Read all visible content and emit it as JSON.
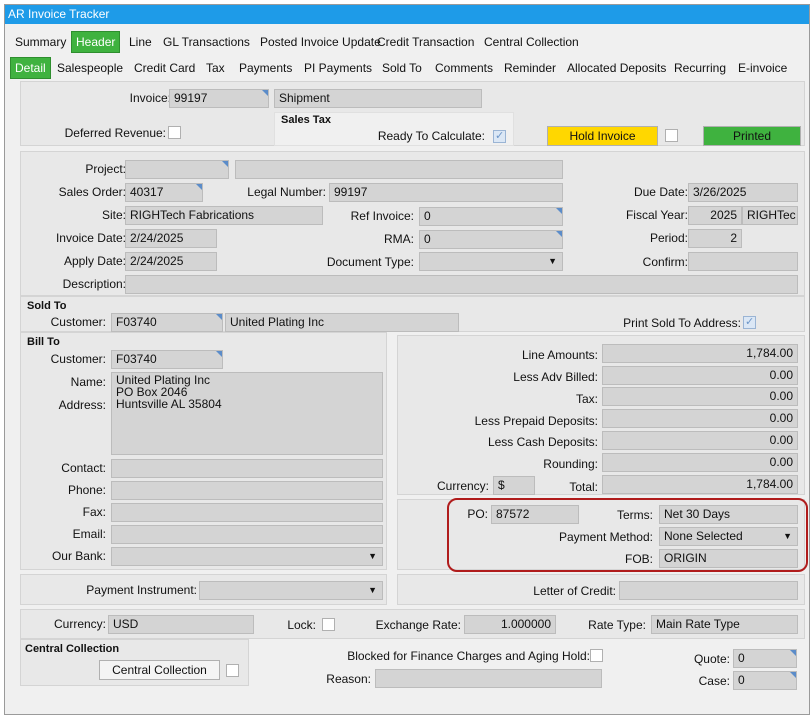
{
  "window": {
    "title": "AR Invoice Tracker"
  },
  "tabs1": [
    "Summary",
    "Header",
    "Line",
    "GL Transactions",
    "Posted Invoice Update",
    "Credit Transaction",
    "Central Collection"
  ],
  "tabs2": [
    "Detail",
    "Salespeople",
    "Credit Card",
    "Tax",
    "Payments",
    "PI Payments",
    "Sold To",
    "Comments",
    "Reminder",
    "Allocated Deposits",
    "Recurring",
    "E-invoice"
  ],
  "top": {
    "invoice_label": "Invoice:",
    "invoice_value": "99197",
    "type_value": "Shipment",
    "deferred_label": "Deferred Revenue:",
    "sales_tax_header": "Sales Tax",
    "ready_label": "Ready To Calculate:",
    "hold_button": "Hold Invoice",
    "printed_button": "Printed"
  },
  "detail": {
    "project_label": "Project:",
    "project_value": "",
    "project_desc": "",
    "sales_order_label": "Sales Order:",
    "sales_order_value": "40317",
    "legal_label": "Legal Number:",
    "legal_value": "99197",
    "due_label": "Due Date:",
    "due_value": "3/26/2025",
    "site_label": "Site:",
    "site_value": "RIGHTech Fabrications",
    "ref_label": "Ref Invoice:",
    "ref_value": "0",
    "fiscal_label": "Fiscal Year:",
    "fiscal_value": "2025",
    "fiscal_company": "RIGHTec",
    "invoice_date_label": "Invoice Date:",
    "invoice_date_value": "2/24/2025",
    "rma_label": "RMA:",
    "rma_value": "0",
    "period_label": "Period:",
    "period_value": "2",
    "apply_label": "Apply Date:",
    "apply_value": "2/24/2025",
    "doctype_label": "Document Type:",
    "doctype_value": "",
    "confirm_label": "Confirm:",
    "confirm_value": "",
    "desc_label": "Description:",
    "desc_value": ""
  },
  "sold_to": {
    "header": "Sold To",
    "customer_label": "Customer:",
    "customer_id": "F03740",
    "customer_name": "United Plating Inc",
    "print_label": "Print Sold To Address:"
  },
  "bill_to": {
    "header": "Bill To",
    "customer_label": "Customer:",
    "customer_id": "F03740",
    "name_label": "Name:",
    "address_label": "Address:",
    "address_lines": [
      "United Plating Inc",
      "PO Box 2046",
      "Huntsville AL 35804"
    ],
    "contact_label": "Contact:",
    "phone_label": "Phone:",
    "fax_label": "Fax:",
    "email_label": "Email:",
    "bank_label": "Our Bank:"
  },
  "amounts": {
    "line_label": "Line Amounts:",
    "line_value": "1,784.00",
    "adv_label": "Less Adv Billed:",
    "adv_value": "0.00",
    "tax_label": "Tax:",
    "tax_value": "0.00",
    "prepaid_label": "Less Prepaid Deposits:",
    "prepaid_value": "0.00",
    "cash_label": "Less Cash Deposits:",
    "cash_value": "0.00",
    "rounding_label": "Rounding:",
    "rounding_value": "0.00",
    "currency_label": "Currency:",
    "currency_value": "$",
    "total_label": "Total:",
    "total_value": "1,784.00"
  },
  "po": {
    "po_label": "PO:",
    "po_value": "87572",
    "terms_label": "Terms:",
    "terms_value": "Net 30 Days",
    "method_label": "Payment Method:",
    "method_value": "None Selected",
    "fob_label": "FOB:",
    "fob_value": "ORIGIN",
    "highlight_color": "#b01c1c"
  },
  "instrument": {
    "label": "Payment Instrument:",
    "value": "",
    "loc_label": "Letter of Credit:",
    "loc_value": ""
  },
  "currency_row": {
    "currency_label": "Currency:",
    "currency_value": "USD",
    "lock_label": "Lock:",
    "rate_label": "Exchange Rate:",
    "rate_value": "1.000000",
    "ratetype_label": "Rate Type:",
    "ratetype_value": "Main Rate Type"
  },
  "central": {
    "header": "Central Collection",
    "button": "Central Collection",
    "blocked_label": "Blocked for Finance Charges and Aging Hold:",
    "reason_label": "Reason:",
    "reason_value": "",
    "quote_label": "Quote:",
    "quote_value": "0",
    "case_label": "Case:",
    "case_value": "0"
  },
  "colors": {
    "title_bar": "#1e9be8",
    "active_tab": "#3fb23f",
    "hold_button": "#ffd700",
    "printed_button": "#3fb23f"
  }
}
